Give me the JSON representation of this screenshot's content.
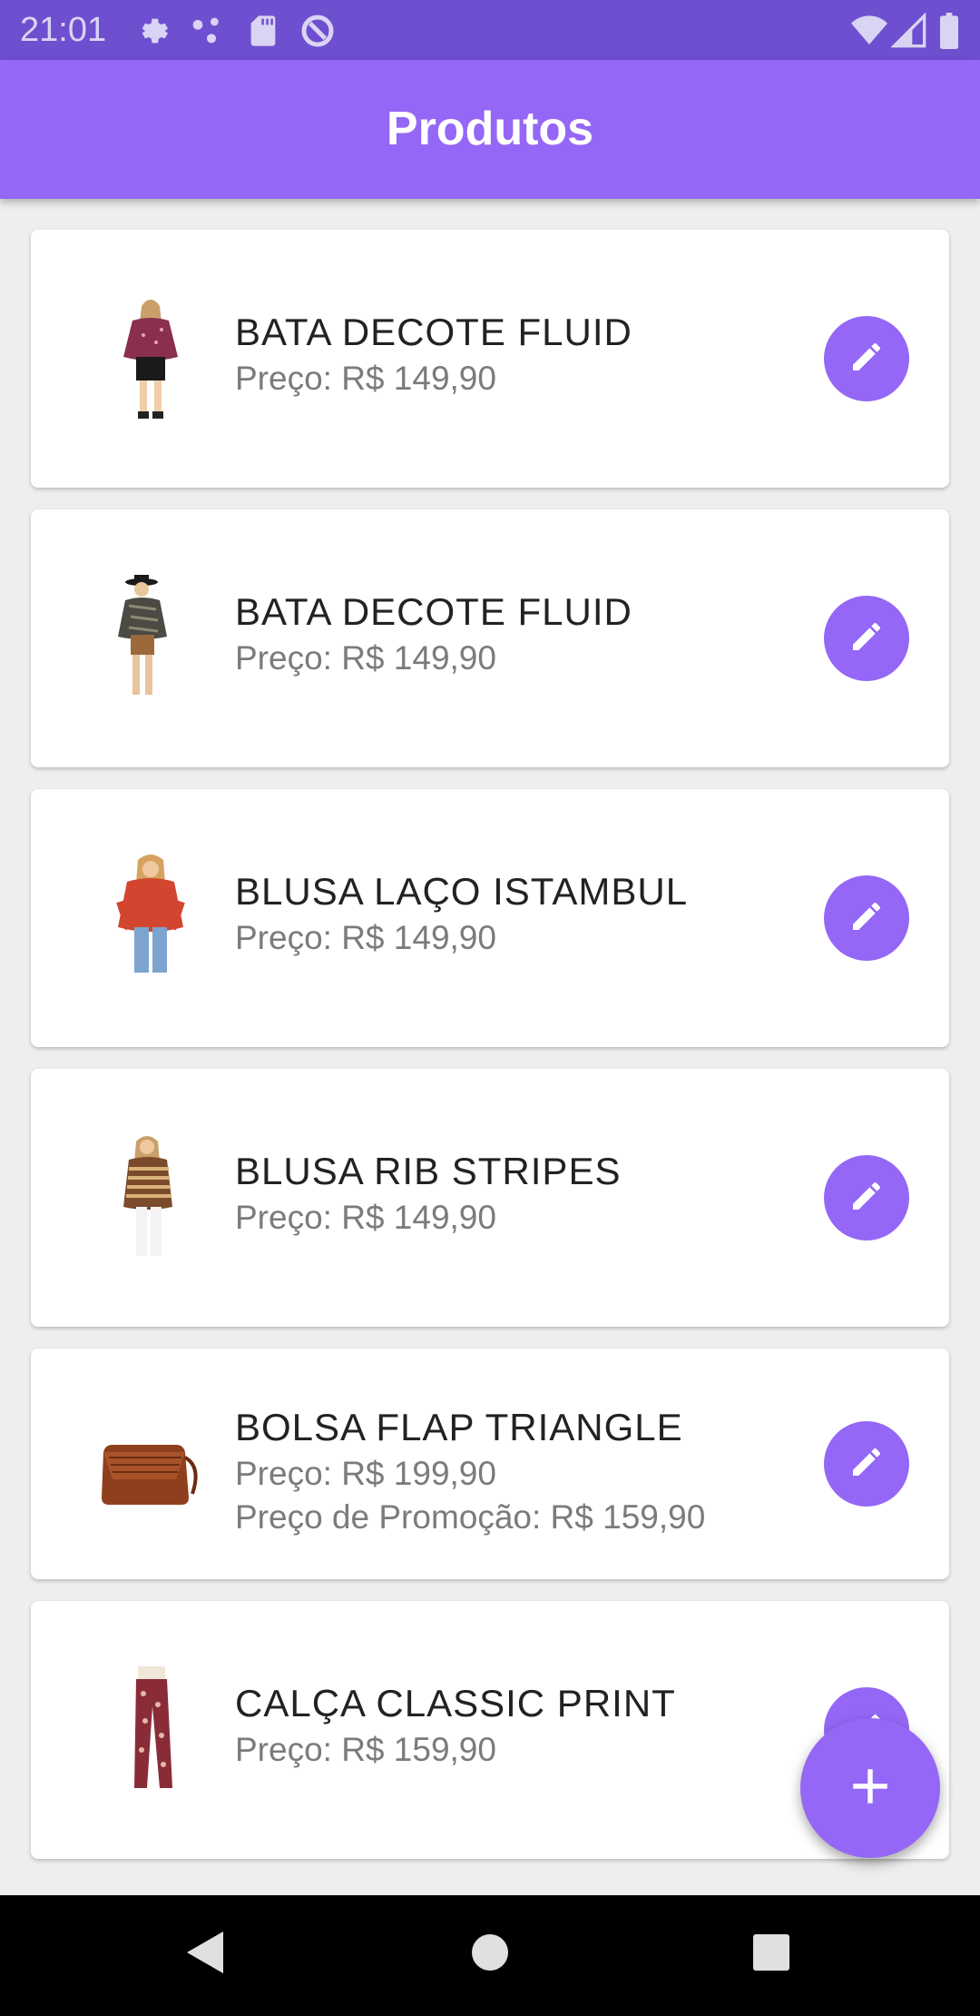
{
  "status_bar": {
    "time": "21:01",
    "left_icons": [
      "settings-icon",
      "share-dots-icon",
      "sd-card-icon",
      "at-sign-icon"
    ],
    "right_icons": [
      "wifi-icon",
      "signal-icon",
      "battery-icon"
    ]
  },
  "app_bar": {
    "title": "Produtos"
  },
  "products": [
    {
      "name": "BATA DECOTE FLUID",
      "price": "Preço: R$ 149,90",
      "edit_icon": "edit-pencil-icon"
    },
    {
      "name": "BATA DECOTE FLUID",
      "price": "Preço: R$ 149,90",
      "edit_icon": "edit-pencil-icon"
    },
    {
      "name": "BLUSA LAÇO ISTAMBUL",
      "price": "Preço: R$ 149,90",
      "edit_icon": "edit-pencil-icon"
    },
    {
      "name": "BLUSA RIB STRIPES",
      "price": "Preço: R$ 149,90",
      "edit_icon": "edit-pencil-icon"
    },
    {
      "name": "BOLSA FLAP TRIANGLE",
      "price": "Preço: R$ 199,90",
      "promo_price": "Preço de Promoção: R$ 159,90",
      "edit_icon": "edit-pencil-icon"
    },
    {
      "name": "CALÇA CLASSIC PRINT",
      "price": "Preço: R$ 159,90",
      "edit_icon": "edit-pencil-icon"
    }
  ],
  "fab": {
    "icon": "add-plus-icon"
  },
  "nav_bar": {
    "icons": [
      "back-triangle-icon",
      "home-circle-icon",
      "recents-square-icon"
    ]
  },
  "colors": {
    "status_bar": "#6e4fcf",
    "primary": "#9467f6",
    "background": "#eeeeee",
    "nav_bar": "#000000"
  }
}
